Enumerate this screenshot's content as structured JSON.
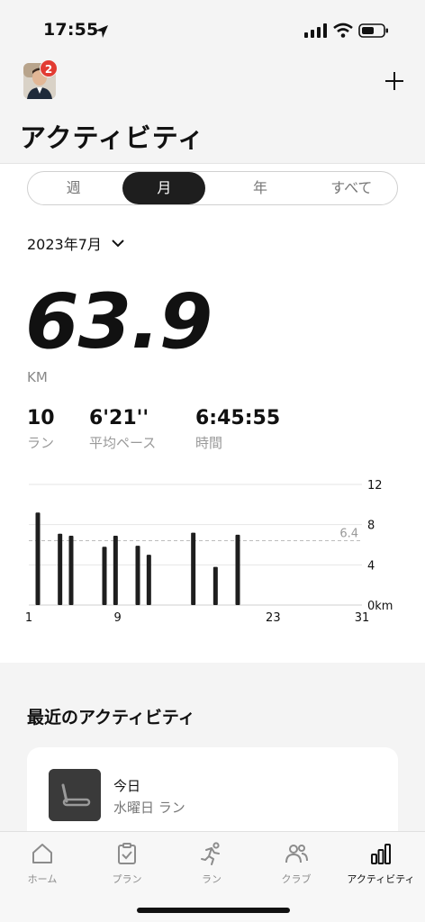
{
  "status": {
    "time": "17:55"
  },
  "header": {
    "title": "アクティビティ",
    "notification_count": "2"
  },
  "segments": [
    "週",
    "月",
    "年",
    "すべて"
  ],
  "period": "2023年7月",
  "summary": {
    "distance": "63.9",
    "unit": "KM",
    "runs": {
      "value": "10",
      "label": "ラン"
    },
    "pace": {
      "value": "6'21''",
      "label": "平均ペース"
    },
    "time": {
      "value": "6:45:55",
      "label": "時間"
    }
  },
  "chart_data": {
    "type": "bar",
    "x": [
      1,
      3,
      4,
      7,
      8,
      10,
      11,
      15,
      17,
      19
    ],
    "values": [
      9.2,
      7.1,
      6.9,
      5.8,
      6.9,
      5.9,
      5.0,
      7.2,
      3.8,
      7.0
    ],
    "xticks": [
      "1",
      "9",
      "23",
      "31"
    ],
    "xlim": [
      1,
      31
    ],
    "yticks": [
      "12",
      "8",
      "4",
      "0km"
    ],
    "ylim": [
      0,
      12
    ],
    "average_label": "6.4",
    "average": 6.4,
    "bar_color": "#1e1e1e"
  },
  "recent": {
    "title": "最近のアクティビティ",
    "item": {
      "title": "今日",
      "subtitle": "水曜日 ラン"
    }
  },
  "tabs": [
    {
      "label": "ホーム",
      "icon": "home-icon"
    },
    {
      "label": "プラン",
      "icon": "clipboard-icon"
    },
    {
      "label": "ラン",
      "icon": "runner-icon"
    },
    {
      "label": "クラブ",
      "icon": "people-icon"
    },
    {
      "label": "アクティビティ",
      "icon": "bar-chart-icon"
    }
  ]
}
